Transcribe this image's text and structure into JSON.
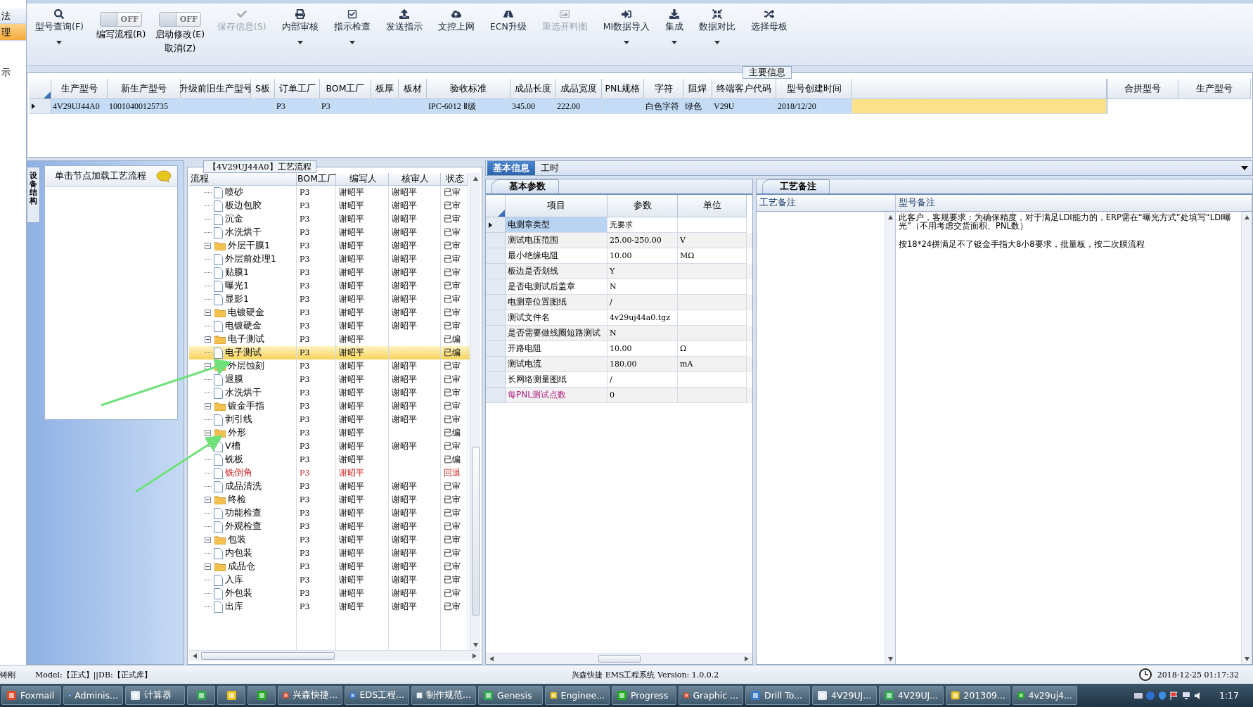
{
  "left_nav": {
    "items": [
      {
        "label": "法",
        "selected": false
      },
      {
        "label": "理",
        "selected": true
      },
      {
        "label": "示",
        "selected": false
      }
    ]
  },
  "toolbar": {
    "items": [
      {
        "kind": "button",
        "label": "型号查询(F)",
        "dropdown": true,
        "disabled": false
      },
      {
        "kind": "toggle",
        "label": "编写流程(R)",
        "state_text": "OFF",
        "on": false
      },
      {
        "kind": "toggle",
        "label": "启动修改(E)",
        "sublabel": "取消(Z)",
        "state_text": "OFF",
        "on": false
      },
      {
        "kind": "button",
        "label": "保存信息(S)",
        "dropdown": false,
        "disabled": true
      },
      {
        "kind": "button",
        "label": "内部审核",
        "dropdown": true,
        "disabled": false
      },
      {
        "kind": "button",
        "label": "指示检查",
        "dropdown": true,
        "disabled": false
      },
      {
        "kind": "button",
        "label": "发送指示",
        "dropdown": false,
        "disabled": false
      },
      {
        "kind": "button",
        "label": "文控上网",
        "dropdown": false,
        "disabled": false
      },
      {
        "kind": "button",
        "label": "ECN升级",
        "dropdown": false,
        "disabled": false
      },
      {
        "kind": "button",
        "label": "重选开料图",
        "dropdown": false,
        "disabled": true
      },
      {
        "kind": "button",
        "label": "MI数据导入",
        "dropdown": true,
        "disabled": false
      },
      {
        "kind": "button",
        "label": "集成",
        "dropdown": true,
        "disabled": false
      },
      {
        "kind": "button",
        "label": "数据对比",
        "dropdown": true,
        "disabled": false
      },
      {
        "kind": "button",
        "label": "选择母板",
        "dropdown": false,
        "disabled": false
      }
    ]
  },
  "main_info": {
    "title": "主要信息",
    "columns": [
      "生产型号",
      "新生产型号",
      "升级前旧生产型号",
      "S板",
      "订单工厂",
      "BOM工厂",
      "板厚",
      "板材",
      "验收标准",
      "成品长度",
      "成品宽度",
      "PNL规格",
      "字符",
      "阻焊",
      "终端客户代码",
      "型号创建时间"
    ],
    "rows": [
      {
        "selected": true,
        "cells": [
          "4V29UJ44A0",
          "10010400125735",
          null,
          null,
          "P3",
          "P3",
          null,
          null,
          "IPC-6012 Ⅱ级",
          "345.00",
          "222.00",
          null,
          "白色字符",
          "绿色",
          "V29U",
          "2018/12/20"
        ]
      }
    ],
    "side_columns": [
      "合拼型号",
      "生产型号"
    ]
  },
  "left_panel": {
    "vertical_tab": "设备结构",
    "header": "单击节点加载工艺流程"
  },
  "process_flow": {
    "title": "【4V29UJ44A0】工艺流程",
    "columns": [
      "流程",
      "BOM工厂",
      "编写人",
      "核审人",
      "状态"
    ],
    "nodes": [
      {
        "kind": "folder-offscreen",
        "children": [
          {
            "kind": "file",
            "label": "喷砂",
            "bom": "P3",
            "writer": "谢昭平",
            "reviewer": "谢昭平",
            "status": "已审",
            "selected": false,
            "rejected": false
          },
          {
            "kind": "file",
            "label": "板边包胶",
            "bom": "P3",
            "writer": "谢昭平",
            "reviewer": "谢昭平",
            "status": "已审",
            "selected": false,
            "rejected": false
          },
          {
            "kind": "file",
            "label": "沉金",
            "bom": "P3",
            "writer": "谢昭平",
            "reviewer": "谢昭平",
            "status": "已审",
            "selected": false,
            "rejected": false
          },
          {
            "kind": "file",
            "label": "水洗烘干",
            "bom": "P3",
            "writer": "谢昭平",
            "reviewer": "谢昭平",
            "status": "已审",
            "selected": false,
            "rejected": false
          }
        ]
      },
      {
        "kind": "folder",
        "label": "外层干膜1",
        "expanded": true,
        "bom": "P3",
        "writer": "谢昭平",
        "reviewer": "谢昭平",
        "status": "已审",
        "selected": false,
        "rejected": false,
        "children": [
          {
            "kind": "file",
            "label": "外层前处理1",
            "bom": "P3",
            "writer": "谢昭平",
            "reviewer": "谢昭平",
            "status": "已审",
            "selected": false,
            "rejected": false
          },
          {
            "kind": "file",
            "label": "贴膜1",
            "bom": "P3",
            "writer": "谢昭平",
            "reviewer": "谢昭平",
            "status": "已审",
            "selected": false,
            "rejected": false
          },
          {
            "kind": "file",
            "label": "曝光1",
            "bom": "P3",
            "writer": "谢昭平",
            "reviewer": "谢昭平",
            "status": "已审",
            "selected": false,
            "rejected": false
          },
          {
            "kind": "file",
            "label": "显影1",
            "bom": "P3",
            "writer": "谢昭平",
            "reviewer": "谢昭平",
            "status": "已审",
            "selected": false,
            "rejected": false
          }
        ]
      },
      {
        "kind": "folder",
        "label": "电镀硬金",
        "expanded": true,
        "bom": "P3",
        "writer": "谢昭平",
        "reviewer": "谢昭平",
        "status": "已审",
        "selected": false,
        "rejected": false,
        "children": [
          {
            "kind": "file",
            "label": "电镀硬金",
            "bom": "P3",
            "writer": "谢昭平",
            "reviewer": "谢昭平",
            "status": "已审",
            "selected": false,
            "rejected": false
          }
        ]
      },
      {
        "kind": "folder",
        "label": "电子测试",
        "expanded": true,
        "bom": "P3",
        "writer": "谢昭平",
        "status": "已编",
        "selected": false,
        "rejected": false,
        "children": [
          {
            "kind": "file",
            "label": "电子测试",
            "bom": "P3",
            "writer": "谢昭平",
            "status": "已编",
            "selected": true,
            "rejected": false
          }
        ]
      },
      {
        "kind": "folder",
        "label": "外层蚀刻",
        "expanded": true,
        "bom": "P3",
        "writer": "谢昭平",
        "reviewer": "谢昭平",
        "status": "已审",
        "selected": false,
        "rejected": false,
        "children": [
          {
            "kind": "file",
            "label": "退膜",
            "bom": "P3",
            "writer": "谢昭平",
            "reviewer": "谢昭平",
            "status": "已审",
            "selected": false,
            "rejected": false
          },
          {
            "kind": "file",
            "label": "水洗烘干",
            "bom": "P3",
            "writer": "谢昭平",
            "reviewer": "谢昭平",
            "status": "已审",
            "selected": false,
            "rejected": false
          }
        ]
      },
      {
        "kind": "folder",
        "label": "镀金手指",
        "expanded": true,
        "bom": "P3",
        "writer": "谢昭平",
        "reviewer": "谢昭平",
        "status": "已审",
        "selected": false,
        "rejected": false,
        "children": [
          {
            "kind": "file",
            "label": "剥引线",
            "bom": "P3",
            "writer": "谢昭平",
            "reviewer": "谢昭平",
            "status": "已审",
            "selected": false,
            "rejected": false
          }
        ]
      },
      {
        "kind": "folder",
        "label": "外形",
        "expanded": true,
        "bom": "P3",
        "writer": "谢昭平",
        "status": "已编",
        "selected": false,
        "rejected": false,
        "children": [
          {
            "kind": "file",
            "label": "V槽",
            "bom": "P3",
            "writer": "谢昭平",
            "reviewer": "谢昭平",
            "status": "已审",
            "selected": false,
            "rejected": false
          },
          {
            "kind": "file",
            "label": "铣板",
            "bom": "P3",
            "writer": "谢昭平",
            "status": "已编",
            "selected": false,
            "rejected": false
          },
          {
            "kind": "file",
            "label": "铣倒角",
            "bom": "P3",
            "writer": "谢昭平",
            "status": "回退",
            "selected": false,
            "rejected": true
          },
          {
            "kind": "file",
            "label": "成品清洗",
            "bom": "P3",
            "writer": "谢昭平",
            "reviewer": "谢昭平",
            "status": "已审",
            "selected": false,
            "rejected": false
          }
        ]
      },
      {
        "kind": "folder",
        "label": "终检",
        "expanded": true,
        "bom": "P3",
        "writer": "谢昭平",
        "reviewer": "谢昭平",
        "status": "已审",
        "selected": false,
        "rejected": false,
        "children": [
          {
            "kind": "file",
            "label": "功能检查",
            "bom": "P3",
            "writer": "谢昭平",
            "reviewer": "谢昭平",
            "status": "已审",
            "selected": false,
            "rejected": false
          },
          {
            "kind": "file",
            "label": "外观检查",
            "bom": "P3",
            "writer": "谢昭平",
            "reviewer": "谢昭平",
            "status": "已审",
            "selected": false,
            "rejected": false
          }
        ]
      },
      {
        "kind": "folder",
        "label": "包装",
        "expanded": true,
        "bom": "P3",
        "writer": "谢昭平",
        "reviewer": "谢昭平",
        "status": "已审",
        "selected": false,
        "rejected": false,
        "children": [
          {
            "kind": "file",
            "label": "内包装",
            "bom": "P3",
            "writer": "谢昭平",
            "reviewer": "谢昭平",
            "status": "已审",
            "selected": false,
            "rejected": false
          }
        ]
      },
      {
        "kind": "folder",
        "label": "成品仓",
        "expanded": true,
        "bom": "P3",
        "writer": "谢昭平",
        "reviewer": "谢昭平",
        "status": "已审",
        "selected": false,
        "rejected": false,
        "children": [
          {
            "kind": "file",
            "label": "入库",
            "bom": "P3",
            "writer": "谢昭平",
            "reviewer": "谢昭平",
            "status": "已审",
            "selected": false,
            "rejected": false
          },
          {
            "kind": "file",
            "label": "外包装",
            "bom": "P3",
            "writer": "谢昭平",
            "reviewer": "谢昭平",
            "status": "已审",
            "selected": false,
            "rejected": false
          },
          {
            "kind": "file",
            "label": "出库",
            "bom": "P3",
            "writer": "谢昭平",
            "reviewer": "谢昭平",
            "status": "已审",
            "selected": false,
            "rejected": false
          }
        ]
      }
    ]
  },
  "detail_tabs": [
    {
      "label": "基本信息",
      "selected": true
    },
    {
      "label": "工时",
      "selected": false
    }
  ],
  "params": {
    "tab": "基本参数",
    "columns": [
      "项目",
      "参数",
      "单位"
    ],
    "rows": [
      {
        "item": "电测章类型",
        "value": "无要求",
        "selected": true,
        "flagged": false
      },
      {
        "item": "测试电压范围",
        "value": "25.00-250.00",
        "unit": "V",
        "selected": false,
        "flagged": false
      },
      {
        "item": "最小绝缘电阻",
        "value": "10.00",
        "unit": "MΩ",
        "selected": false,
        "flagged": false
      },
      {
        "item": "板边是否划线",
        "value": "Y",
        "selected": false,
        "flagged": false
      },
      {
        "item": "是否电测试后盖章",
        "value": "N",
        "selected": false,
        "flagged": false
      },
      {
        "item": "电测章位置图纸",
        "value": "/",
        "selected": false,
        "flagged": false
      },
      {
        "item": "测试文件名",
        "value": "4v29uj44a0.tgz",
        "selected": false,
        "flagged": false
      },
      {
        "item": "是否需要做线圈短路测试",
        "value": "N",
        "selected": false,
        "flagged": false
      },
      {
        "item": "开路电阻",
        "value": "10.00",
        "unit": "Ω",
        "selected": false,
        "flagged": false
      },
      {
        "item": "测试电流",
        "value": "180.00",
        "unit": "mA",
        "selected": false,
        "flagged": false
      },
      {
        "item": "长网络测量图纸",
        "value": "/",
        "selected": false,
        "flagged": false
      },
      {
        "item": "每PNL测试点数",
        "value": "0",
        "selected": false,
        "flagged": true
      }
    ]
  },
  "notes": {
    "tab": "工艺备注",
    "columns": [
      "工艺备注",
      "型号备注"
    ],
    "model_notes": [
      "此客户，客规要求：为确保精度，对于满足LDI能力的，ERP需在“曝光方式”处填写“LDI曝光”（不用考虑交货面积、PNL数）",
      "按18*24拼满足不了镀金手指大8小8要求，批量板，按二次膜流程"
    ]
  },
  "status_bar": {
    "user": "铸刚",
    "model_db": "Model:【正式】||DB:【正式库】",
    "app": "兴森快捷 EMS工程系统 Version: 1.0.0.2",
    "datetime": "2018-12-25 01:17:32"
  },
  "taskbar": {
    "items": [
      {
        "kind": "app",
        "label": "Foxmail"
      },
      {
        "kind": "app",
        "label": "Adminis..."
      },
      {
        "kind": "app",
        "label": "计算器"
      },
      {
        "kind": "icon"
      },
      {
        "kind": "icon"
      },
      {
        "kind": "icon"
      },
      {
        "kind": "app",
        "label": "兴森快捷..."
      },
      {
        "kind": "app",
        "label": "EDS工程..."
      },
      {
        "kind": "app",
        "label": "制作规范..."
      },
      {
        "kind": "app",
        "label": "Genesis"
      },
      {
        "kind": "app",
        "label": "Enginee..."
      },
      {
        "kind": "app",
        "label": "Progress"
      },
      {
        "kind": "app",
        "label": "Graphic ..."
      },
      {
        "kind": "app",
        "label": "Drill To..."
      },
      {
        "kind": "app",
        "label": "4V29UJ..."
      },
      {
        "kind": "app",
        "label": "4V29UJ..."
      },
      {
        "kind": "app",
        "label": "201309..."
      },
      {
        "kind": "app",
        "label": "4v29uj4..."
      }
    ],
    "clock": "1:17"
  }
}
